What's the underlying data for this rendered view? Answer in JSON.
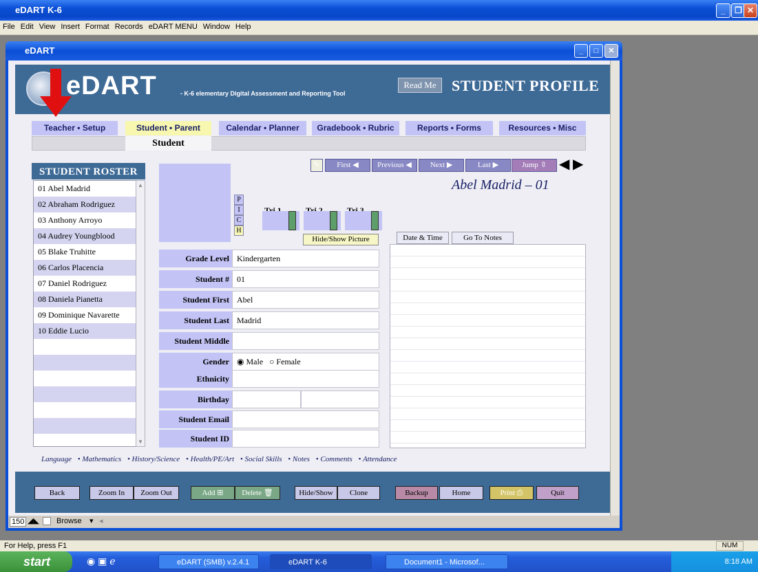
{
  "app": {
    "title": "eDART K-6"
  },
  "menu": [
    "File",
    "Edit",
    "View",
    "Insert",
    "Format",
    "Records",
    "eDART MENU",
    "Window",
    "Help"
  ],
  "document": {
    "title": "eDART"
  },
  "banner": {
    "brand": "eDART",
    "subtitle": "- K-6 elementary Digital Assessment and Reporting Tool",
    "readme": "Read Me",
    "section_title": "STUDENT PROFILE"
  },
  "tabs": [
    {
      "label": "Teacher • Setup",
      "active": false
    },
    {
      "label": "Student • Parent",
      "active": true
    },
    {
      "label": "Calendar • Planner",
      "active": false
    },
    {
      "label": "Gradebook • Rubric",
      "active": false
    },
    {
      "label": "Reports • Forms",
      "active": false
    },
    {
      "label": "Resources • Misc",
      "active": false
    }
  ],
  "subtab": "Student",
  "nav": {
    "first": "First",
    "previous": "Previous",
    "next": "Next",
    "last": "Last",
    "jump": "Jump"
  },
  "roster": {
    "title": "STUDENT ROSTER",
    "items": [
      "01  Abel Madrid",
      "02  Abraham Rodriguez",
      "03  Anthony Arroyo",
      "04  Audrey Youngblood",
      "05  Blake Truhitte",
      "06  Carlos Placencia",
      "07  Daniel Rodriguez",
      "08  Daniela Pianetta",
      "09  Dominique Navarette",
      "10  Eddie Lucio",
      "",
      "",
      "",
      "",
      "",
      "",
      ""
    ]
  },
  "picture": {
    "letters": [
      "P",
      "I",
      "C",
      "H"
    ],
    "tri_labels": [
      "Tri 1",
      "Tri 2",
      "Tri 3"
    ],
    "hide_show_tip": "Hide/Show Picture"
  },
  "student_display_name": "Abel Madrid – 01",
  "fields": {
    "grade_level": {
      "label": "Grade Level",
      "value": "Kindergarten"
    },
    "student_num": {
      "label": "Student #",
      "value": "01"
    },
    "first": {
      "label": "Student First",
      "value": "Abel"
    },
    "last": {
      "label": "Student Last",
      "value": "Madrid"
    },
    "middle": {
      "label": "Student Middle",
      "value": ""
    },
    "gender": {
      "label": "Gender",
      "male": "Male",
      "female": "Female",
      "selected": "Male"
    },
    "ethnicity": {
      "label": "Ethnicity",
      "value": ""
    },
    "birthday": {
      "label": "Birthday",
      "value": ""
    },
    "email": {
      "label": "Student Email",
      "value": ""
    },
    "student_id": {
      "label": "Student ID",
      "value": ""
    }
  },
  "notes": {
    "date_time": "Date & Time",
    "go_to_notes": "Go To Notes"
  },
  "subject_links": [
    "Language",
    "Mathematics",
    "History/Science",
    "Health/PE/Art",
    "Social Skills",
    "Notes",
    "Comments",
    "Attendance"
  ],
  "bottom_buttons": {
    "back": "Back",
    "zoom_in": "Zoom In",
    "zoom_out": "Zoom Out",
    "add": "Add",
    "delete": "Delete",
    "hide_show": "Hide/Show",
    "clone": "Clone",
    "backup": "Backup",
    "home": "Home",
    "print": "Print",
    "quit": "Quit"
  },
  "doc_status": {
    "zoom": "150",
    "mode": "Browse"
  },
  "status_bar": {
    "help": "For Help, press F1",
    "num": "NUM"
  },
  "taskbar": {
    "start": "start",
    "tasks": [
      "eDART (SMB) v.2.4.1",
      "eDART K-6",
      "Document1 - Microsof..."
    ],
    "clock": "8:18 AM"
  }
}
